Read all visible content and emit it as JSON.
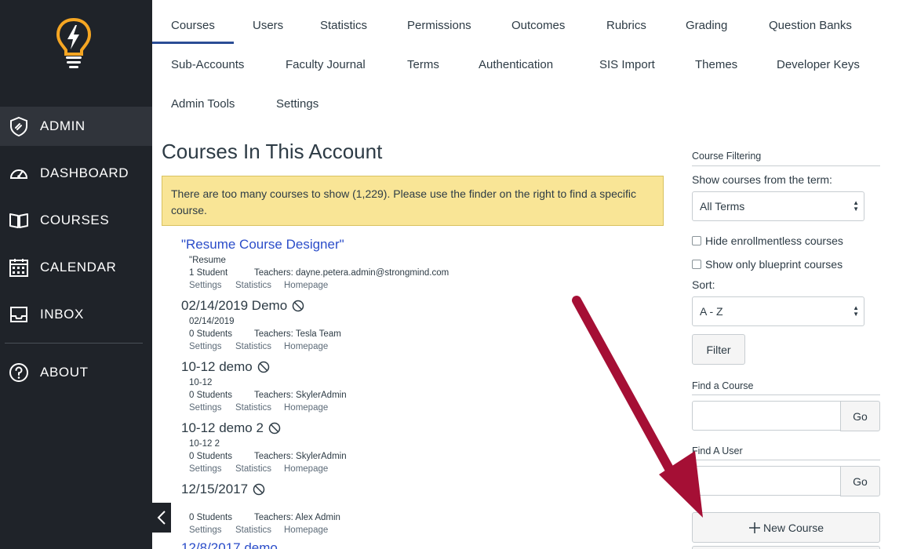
{
  "sidebar": {
    "items": [
      {
        "label": "ADMIN",
        "icon": "shield-icon"
      },
      {
        "label": "DASHBOARD",
        "icon": "speedometer-icon"
      },
      {
        "label": "COURSES",
        "icon": "book-icon"
      },
      {
        "label": "CALENDAR",
        "icon": "calendar-icon"
      },
      {
        "label": "INBOX",
        "icon": "inbox-icon"
      },
      {
        "label": "ABOUT",
        "icon": "question-icon"
      }
    ]
  },
  "tabs": [
    "Courses",
    "Users",
    "Statistics",
    "Permissions",
    "Outcomes",
    "Rubrics",
    "Grading",
    "Question Banks",
    "Sub-Accounts",
    "Faculty Journal",
    "Terms",
    "Authentication",
    "SIS Import",
    "Themes",
    "Developer Keys",
    "Admin Tools",
    "Settings"
  ],
  "main": {
    "title": "Courses In This Account",
    "alert": "There are too many courses to show (1,229). Please use the finder on the right to find a specific course.",
    "courses": [
      {
        "title": "\"Resume Course Designer\"",
        "code": "\"Resume",
        "students": "1 Student",
        "teachers": "Teachers: dayne.petera.admin@strongmind.com"
      },
      {
        "title": "02/14/2019 Demo",
        "code": "02/14/2019",
        "students": "0 Students",
        "teachers": "Teachers: Tesla Team"
      },
      {
        "title": "10-12 demo",
        "code": "10-12",
        "students": "0 Students",
        "teachers": "Teachers: SkylerAdmin"
      },
      {
        "title": "10-12 demo 2",
        "code": "10-12 2",
        "students": "0 Students",
        "teachers": "Teachers: SkylerAdmin"
      },
      {
        "title": "12/15/2017",
        "code": "",
        "students": "0 Students",
        "teachers": "Teachers: Alex Admin"
      },
      {
        "title": "12/8/2017 demo"
      }
    ],
    "links": {
      "settings": "Settings",
      "statistics": "Statistics",
      "homepage": "Homepage"
    }
  },
  "filter": {
    "heading": "Course Filtering",
    "term_label": "Show courses from the term:",
    "term_value": "All Terms",
    "hide_enrollmentless": "Hide enrollmentless courses",
    "show_blueprint": "Show only blueprint courses",
    "sort_label": "Sort:",
    "sort_value": "A - Z",
    "filter_button": "Filter",
    "find_course_heading": "Find a Course",
    "find_user_heading": "Find A User",
    "go_label": "Go",
    "new_course_label": "New Course"
  },
  "colors": {
    "sidebar": "#1f2329",
    "accent": "#2b4d95",
    "alert": "#f9e596",
    "arrow": "#a50f35"
  }
}
